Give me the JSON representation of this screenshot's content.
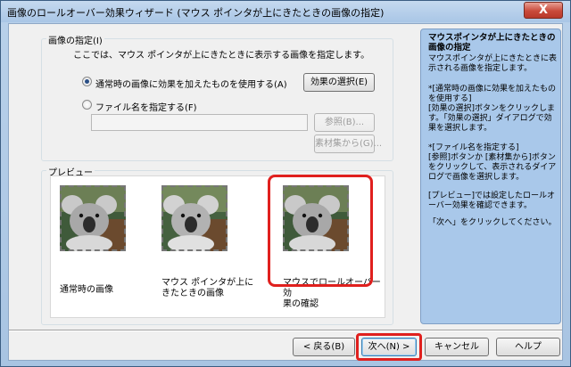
{
  "window": {
    "title": "画像のロールオーバー効果ウィザード (マウス ポインタが上にきたときの画像の指定)",
    "close_label": "X"
  },
  "image_group": {
    "legend": "画像の指定(I)",
    "description": "ここでは、マウス ポインタが上にきたときに表示する画像を指定します。",
    "option_effect_label": "通常時の画像に効果を加えたものを使用する(A)",
    "option_effect_checked": true,
    "effect_button": "効果の選択(E)",
    "option_file_label": "ファイル名を指定する(F)",
    "option_file_checked": false,
    "file_input_value": "",
    "browse_button": "参照(B)...",
    "materials_button": "素材集から(G)..."
  },
  "preview_group": {
    "legend": "プレビュー",
    "items": [
      {
        "caption": "通常時の画像"
      },
      {
        "caption": "マウス ポインタが上に\nきたときの画像"
      },
      {
        "caption": "マウスでロールオーバー効\n果の確認"
      }
    ]
  },
  "help": {
    "title": "マウスポインタが上にきたときの画像の指定",
    "intro": "マウスポインタが上にきたときに表示される画像を指定します。",
    "para1": "*[通常時の画像に効果を加えたものを使用する]\n[効果の選択]ボタンをクリックします。「効果の選択」ダイアログで効果を選択します。",
    "para2": "*[ファイル名を指定する]\n[参照]ボタンか [素材集から]ボタンをクリックして、表示されるダイアログで画像を選択します。",
    "para3": "[プレビュー]では設定したロールオーバー効果を確認できます。",
    "para4": "「次へ」をクリックしてください。"
  },
  "footer": {
    "back_button": "< 戻る(B)",
    "next_button": "次へ(N) >",
    "cancel_button": "キャンセル",
    "help_button": "ヘルプ"
  },
  "colors": {
    "highlight": "#e0201e",
    "help_pane": "#a9c8ea",
    "radio_dot": "#2b4f86"
  }
}
